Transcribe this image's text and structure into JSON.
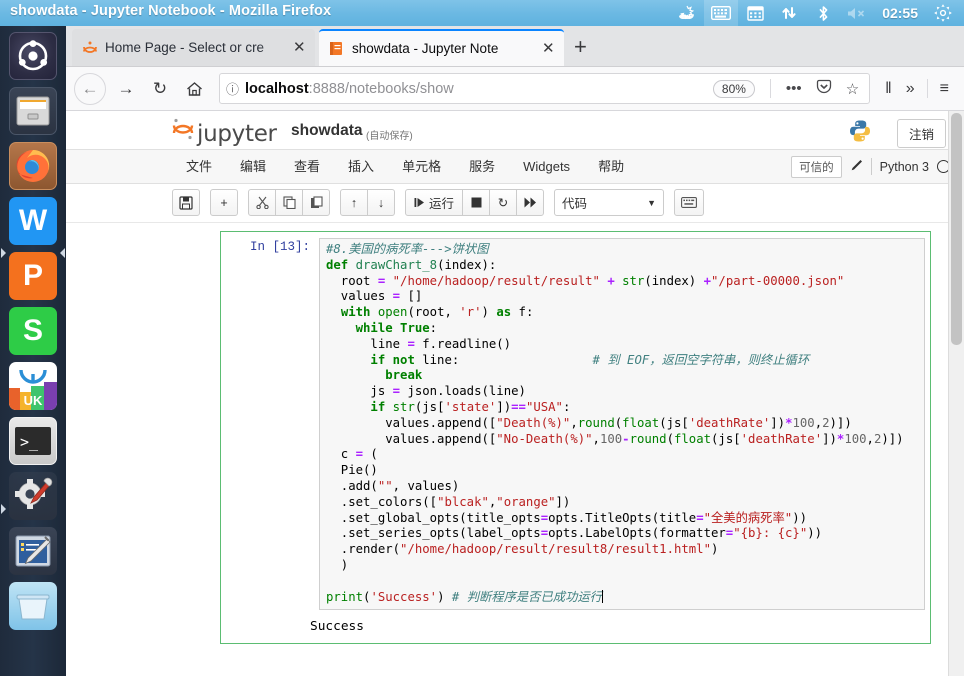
{
  "window": {
    "title": "showdata - Jupyter Notebook - Mozilla Firefox"
  },
  "tray": {
    "items": [
      {
        "name": "update-icon",
        "glyph": "☀"
      },
      {
        "name": "keyboard-icon",
        "glyph": "⌨"
      },
      {
        "name": "calendar-icon",
        "glyph": "Ὄ5"
      },
      {
        "name": "network-icon",
        "glyph": "⇅"
      },
      {
        "name": "bluetooth-icon",
        "glyph": "ᛦ"
      },
      {
        "name": "volume-muted-icon",
        "glyph": "ὐ7"
      }
    ],
    "clock": "02:55",
    "settings_glyph": "⚙"
  },
  "launcher": {
    "items": [
      {
        "name": "ubuntu-dash-icon",
        "label": "Ubuntu Dash"
      },
      {
        "name": "files-icon",
        "label": "Files"
      },
      {
        "name": "firefox-icon",
        "label": "Firefox"
      },
      {
        "name": "wps-writer-icon",
        "label": "WPS Writer",
        "letter": "W"
      },
      {
        "name": "wps-presentation-icon",
        "label": "WPS Presentation",
        "letter": "P"
      },
      {
        "name": "wps-spreadsheet-icon",
        "label": "WPS Spreadsheets",
        "letter": "S"
      },
      {
        "name": "ubuntu-software-icon",
        "label": "Ubuntu Software",
        "letter": "UK"
      },
      {
        "name": "terminal-icon",
        "label": "Terminal"
      },
      {
        "name": "system-settings-icon",
        "label": "System Settings"
      },
      {
        "name": "text-editor-icon",
        "label": "Text Editor"
      },
      {
        "name": "trash-icon",
        "label": "Trash"
      }
    ]
  },
  "browser": {
    "tabs": [
      {
        "label": "Home Page - Select or cre",
        "favicon": "jupyter-logo-icon",
        "active": false
      },
      {
        "label": "showdata - Jupyter Note",
        "favicon": "notebook-icon",
        "active": true
      }
    ],
    "new_tab_glyph": "+",
    "close_glyph": "✕",
    "nav": {
      "back": "←",
      "forward": "→",
      "reload": "↻",
      "home": "⌂"
    },
    "url": {
      "host": "localhost",
      "path": ":8888/notebooks/show",
      "info_glyph": "ⓘ"
    },
    "zoom": "80%",
    "page_actions": "•••",
    "shield_glyph": "Ὦ1",
    "star_glyph": "☆",
    "library_glyph": "‖",
    "overflow_glyph": "»",
    "menu_glyph": "≡"
  },
  "jupyter": {
    "brand": "jupyter",
    "notebook_name": "showdata",
    "autosave_label": "(自动保存)",
    "logout_label": "注销",
    "menu": [
      "文件",
      "编辑",
      "查看",
      "插入",
      "单元格",
      "服务",
      "Widgets",
      "帮助"
    ],
    "trusted_label": "可信的",
    "kernel_name": "Python 3",
    "toolbar": {
      "save": "💾",
      "insert_below": "+",
      "cut": "✂",
      "copy": "⧉",
      "paste": "⎘",
      "move_up": "↑",
      "move_down": "↓",
      "run_label": "运行",
      "run_glyph": "⏮",
      "interrupt": "■",
      "restart": "↻",
      "restart_run_all": "⏩",
      "cell_type": "代码",
      "command_palette": "⌨"
    }
  },
  "cell": {
    "prompt": "In [13]:",
    "code_lines": [
      [
        {
          "t": "#8.美国的病死率--->饼状图",
          "c": "c"
        }
      ],
      [
        {
          "t": "def ",
          "c": "k"
        },
        {
          "t": "drawChart_8",
          "c": "n"
        },
        {
          "t": "(index):",
          "c": ""
        }
      ],
      [
        {
          "t": "  root ",
          "c": ""
        },
        {
          "t": "=",
          "c": "o"
        },
        {
          "t": " ",
          "c": ""
        },
        {
          "t": "\"/home/hadoop/result/result\"",
          "c": "s"
        },
        {
          "t": " ",
          "c": ""
        },
        {
          "t": "+",
          "c": "o"
        },
        {
          "t": " ",
          "c": ""
        },
        {
          "t": "str",
          "c": "nb"
        },
        {
          "t": "(index) ",
          "c": ""
        },
        {
          "t": "+",
          "c": "o"
        },
        {
          "t": "\"/part-00000.json\"",
          "c": "s"
        }
      ],
      [
        {
          "t": "  values ",
          "c": ""
        },
        {
          "t": "=",
          "c": "o"
        },
        {
          "t": " []",
          "c": ""
        }
      ],
      [
        {
          "t": "  ",
          "c": ""
        },
        {
          "t": "with ",
          "c": "k"
        },
        {
          "t": "open",
          "c": "nb"
        },
        {
          "t": "(root, ",
          "c": ""
        },
        {
          "t": "'r'",
          "c": "s"
        },
        {
          "t": ") ",
          "c": ""
        },
        {
          "t": "as ",
          "c": "k"
        },
        {
          "t": "f:",
          "c": ""
        }
      ],
      [
        {
          "t": "    ",
          "c": ""
        },
        {
          "t": "while True",
          "c": "k"
        },
        {
          "t": ":",
          "c": ""
        }
      ],
      [
        {
          "t": "      line ",
          "c": ""
        },
        {
          "t": "=",
          "c": "o"
        },
        {
          "t": " f.readline()",
          "c": ""
        }
      ],
      [
        {
          "t": "      ",
          "c": ""
        },
        {
          "t": "if not ",
          "c": "k"
        },
        {
          "t": "line:",
          "c": ""
        },
        {
          "t": "                  ",
          "c": ""
        },
        {
          "t": "# 到 EOF，返回空字符串，则终止循环",
          "c": "c"
        }
      ],
      [
        {
          "t": "        ",
          "c": ""
        },
        {
          "t": "break",
          "c": "k"
        }
      ],
      [
        {
          "t": "      js ",
          "c": ""
        },
        {
          "t": "=",
          "c": "o"
        },
        {
          "t": " json.loads(line)",
          "c": ""
        }
      ],
      [
        {
          "t": "      ",
          "c": ""
        },
        {
          "t": "if ",
          "c": "k"
        },
        {
          "t": "str",
          "c": "nb"
        },
        {
          "t": "(js[",
          "c": ""
        },
        {
          "t": "'state'",
          "c": "s"
        },
        {
          "t": "])",
          "c": ""
        },
        {
          "t": "==",
          "c": "o"
        },
        {
          "t": "\"USA\"",
          "c": "s"
        },
        {
          "t": ":",
          "c": ""
        }
      ],
      [
        {
          "t": "        values.append([",
          "c": ""
        },
        {
          "t": "\"Death(%)\"",
          "c": "s"
        },
        {
          "t": ",",
          "c": ""
        },
        {
          "t": "round",
          "c": "nb"
        },
        {
          "t": "(",
          "c": ""
        },
        {
          "t": "float",
          "c": "nb"
        },
        {
          "t": "(js[",
          "c": ""
        },
        {
          "t": "'deathRate'",
          "c": "s"
        },
        {
          "t": "])",
          "c": ""
        },
        {
          "t": "*",
          "c": "o"
        },
        {
          "t": "100",
          "c": "num"
        },
        {
          "t": ",",
          "c": ""
        },
        {
          "t": "2",
          "c": "num"
        },
        {
          "t": ")])",
          "c": ""
        }
      ],
      [
        {
          "t": "        values.append([",
          "c": ""
        },
        {
          "t": "\"No-Death(%)\"",
          "c": "s"
        },
        {
          "t": ",",
          "c": ""
        },
        {
          "t": "100",
          "c": "num"
        },
        {
          "t": "-",
          "c": "o"
        },
        {
          "t": "round",
          "c": "nb"
        },
        {
          "t": "(",
          "c": ""
        },
        {
          "t": "float",
          "c": "nb"
        },
        {
          "t": "(js[",
          "c": ""
        },
        {
          "t": "'deathRate'",
          "c": "s"
        },
        {
          "t": "])",
          "c": ""
        },
        {
          "t": "*",
          "c": "o"
        },
        {
          "t": "100",
          "c": "num"
        },
        {
          "t": ",",
          "c": ""
        },
        {
          "t": "2",
          "c": "num"
        },
        {
          "t": ")])",
          "c": ""
        }
      ],
      [
        {
          "t": "  c ",
          "c": ""
        },
        {
          "t": "=",
          "c": "o"
        },
        {
          "t": " (",
          "c": ""
        }
      ],
      [
        {
          "t": "  Pie()",
          "c": ""
        }
      ],
      [
        {
          "t": "  .add(",
          "c": ""
        },
        {
          "t": "\"\"",
          "c": "s"
        },
        {
          "t": ", values)",
          "c": ""
        }
      ],
      [
        {
          "t": "  .set_colors([",
          "c": ""
        },
        {
          "t": "\"blcak\"",
          "c": "s"
        },
        {
          "t": ",",
          "c": ""
        },
        {
          "t": "\"orange\"",
          "c": "s"
        },
        {
          "t": "])",
          "c": ""
        }
      ],
      [
        {
          "t": "  .set_global_opts(title_opts",
          "c": ""
        },
        {
          "t": "=",
          "c": "o"
        },
        {
          "t": "opts.TitleOpts(title",
          "c": ""
        },
        {
          "t": "=",
          "c": "o"
        },
        {
          "t": "\"全美的病死率\"",
          "c": "s"
        },
        {
          "t": "))",
          "c": ""
        }
      ],
      [
        {
          "t": "  .set_series_opts(label_opts",
          "c": ""
        },
        {
          "t": "=",
          "c": "o"
        },
        {
          "t": "opts.LabelOpts(formatter",
          "c": ""
        },
        {
          "t": "=",
          "c": "o"
        },
        {
          "t": "\"{b}: {c}\"",
          "c": "s"
        },
        {
          "t": "))",
          "c": ""
        }
      ],
      [
        {
          "t": "  .render(",
          "c": ""
        },
        {
          "t": "\"/home/hadoop/result/result8/result1.html\"",
          "c": "s"
        },
        {
          "t": ")",
          "c": ""
        }
      ],
      [
        {
          "t": "  )",
          "c": ""
        }
      ],
      [
        {
          "t": "",
          "c": ""
        }
      ],
      [
        {
          "t": "print",
          "c": "nb"
        },
        {
          "t": "(",
          "c": ""
        },
        {
          "t": "'Success'",
          "c": "s"
        },
        {
          "t": ") ",
          "c": ""
        },
        {
          "t": "# 判断程序是否已成功运行",
          "c": "c"
        }
      ]
    ],
    "output": "Success"
  },
  "colors": {
    "cell_selected_border": "#5bbd72",
    "tab_active_accent": "#0a84ff",
    "titlebar": "#6cb9e3"
  }
}
